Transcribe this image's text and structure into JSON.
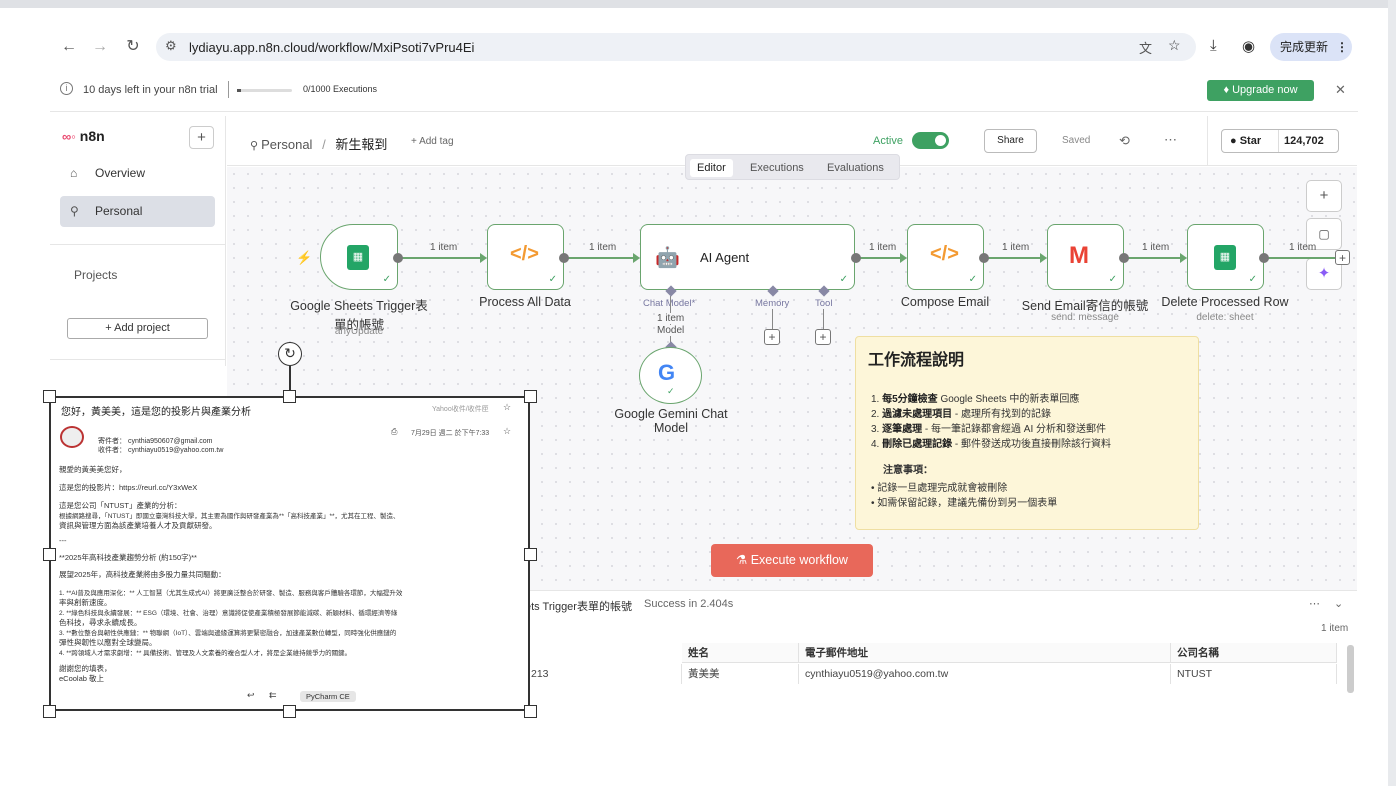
{
  "browser": {
    "url": "lydiayu.app.n8n.cloud/workflow/MxiPsoti7vPru4Ei",
    "update_button": "完成更新"
  },
  "trial": {
    "days_left": "10 days left in your n8n trial",
    "executions": "0/1000 Executions",
    "executions_used_fraction": 0.0,
    "upgrade": "Upgrade now"
  },
  "sidebar": {
    "brand": "n8n",
    "items": [
      {
        "label": "Overview"
      },
      {
        "label": "Personal"
      }
    ],
    "projects_label": "Projects",
    "add_project": "+ Add project"
  },
  "header": {
    "breadcrumb_project": "Personal",
    "breadcrumb_sep": "/",
    "workflow_name": "新生報到",
    "add_tag": "+ Add tag",
    "active_label": "Active",
    "share": "Share",
    "saved": "Saved",
    "star": "Star",
    "star_count": "124,702"
  },
  "tabs": [
    "Editor",
    "Executions",
    "Evaluations"
  ],
  "nodes": [
    {
      "title_line1": "Google Sheets Trigger表",
      "title_line2": "單的帳號",
      "subtitle": "anyUpdate"
    },
    {
      "title": "Process All Data"
    },
    {
      "title": "AI Agent",
      "ports": [
        "Chat Model*",
        "Memory",
        "Tool"
      ]
    },
    {
      "title": "Compose Email"
    },
    {
      "title": "Send Email寄信的帳號",
      "subtitle": "send: message"
    },
    {
      "title": "Delete Processed Row",
      "subtitle": "delete: sheet"
    },
    {
      "title_line1": "Google Gemini Chat",
      "title_line2": "Model"
    }
  ],
  "connections": {
    "item_label": "1 item",
    "model_items_line1": "1 item",
    "model_items_line2": "Model",
    "last_label": "1 item"
  },
  "note": {
    "title": "工作流程說明",
    "items": [
      {
        "bold": "每5分鐘檢查",
        "text": " Google Sheets 中的新表單回應",
        "num": "1."
      },
      {
        "bold": "過濾未處理項目",
        "text": " - 處理所有找到的記錄",
        "num": "2."
      },
      {
        "bold": "逐筆處理",
        "text": " - 每一筆記錄都會經過 AI 分析和發送郵件",
        "num": "3."
      },
      {
        "bold": "刪除已處理記錄",
        "text": " - 郵件發送成功後直接刪除該行資料",
        "num": "4."
      }
    ],
    "notes_title": "注意事項：",
    "notes": [
      "記錄一旦處理完成就會被刪除",
      "如需保留記錄，建議先備份到另一個表單"
    ]
  },
  "execute_button": "Execute workflow",
  "output": {
    "title": "ets Trigger表單的帳號",
    "status": "Success in 2.404s",
    "item_count": "1 item",
    "columns": [
      "姓名",
      "電子郵件地址",
      "公司名稱"
    ],
    "row": {
      "id": "213",
      "name": "黃美美",
      "email": "cynthiayu0519@yahoo.com.tw",
      "company": "NTUST"
    }
  },
  "email": {
    "subject": "您好，黃美美，這是您的投影片與產業分析",
    "tag": "Yahoo收件/收件匣",
    "from": "寄件者：   cynthia950607@gmail.com",
    "to": "收件者：   cynthiayu0519@yahoo.com.tw",
    "date": "7月29日 週二 於下午7:33",
    "body": [
      "親愛的黃美美您好，",
      "這是您的投影片：https://reurl.cc/Y3xWeX",
      "這是您公司「NTUST」產業的分析：",
      "根據網路搜尋，「NTUST」即國立臺灣科技大學，其主要為國作與研發產業為**「高科技產業」**，尤其在工程、製造、",
      "資訊與管理方面為該產業培養人才及貢獻研發。",
      "---",
      "**2025年高科技產業趨勢分析 (約150字)**",
      "展望2025年，高科技產業將由多股力量共同驅動：",
      "1. **AI普及與應用深化：** 人工智慧（尤其生成式AI）將更廣泛整合於研發、製造、服務與客戶體驗各環節，大幅提升效",
      "率與創新速度。",
      "2. **綠色科技與永續發展：** ESG（環境、社會、治理）意識將促使產業積極發展節能減碳、新穎材料、循環經濟等綠",
      "色科技，尋求永續成長。",
      "3. **數位整合與韌性供應鏈：** 物聯網（IoT）、雲端與邊緣運算將更緊密融合，加速產業數位轉型，同時強化供應鏈的",
      "彈性與韌性以應對全球變局。",
      "4. **跨領域人才需求劇增：** 具備技術、管理及人文素養的複合型人才，將是企業維持競爭力的關鍵。",
      "謝謝您的填表，",
      "eCoolab 敬上"
    ],
    "app_label": "PyCharm CE"
  }
}
